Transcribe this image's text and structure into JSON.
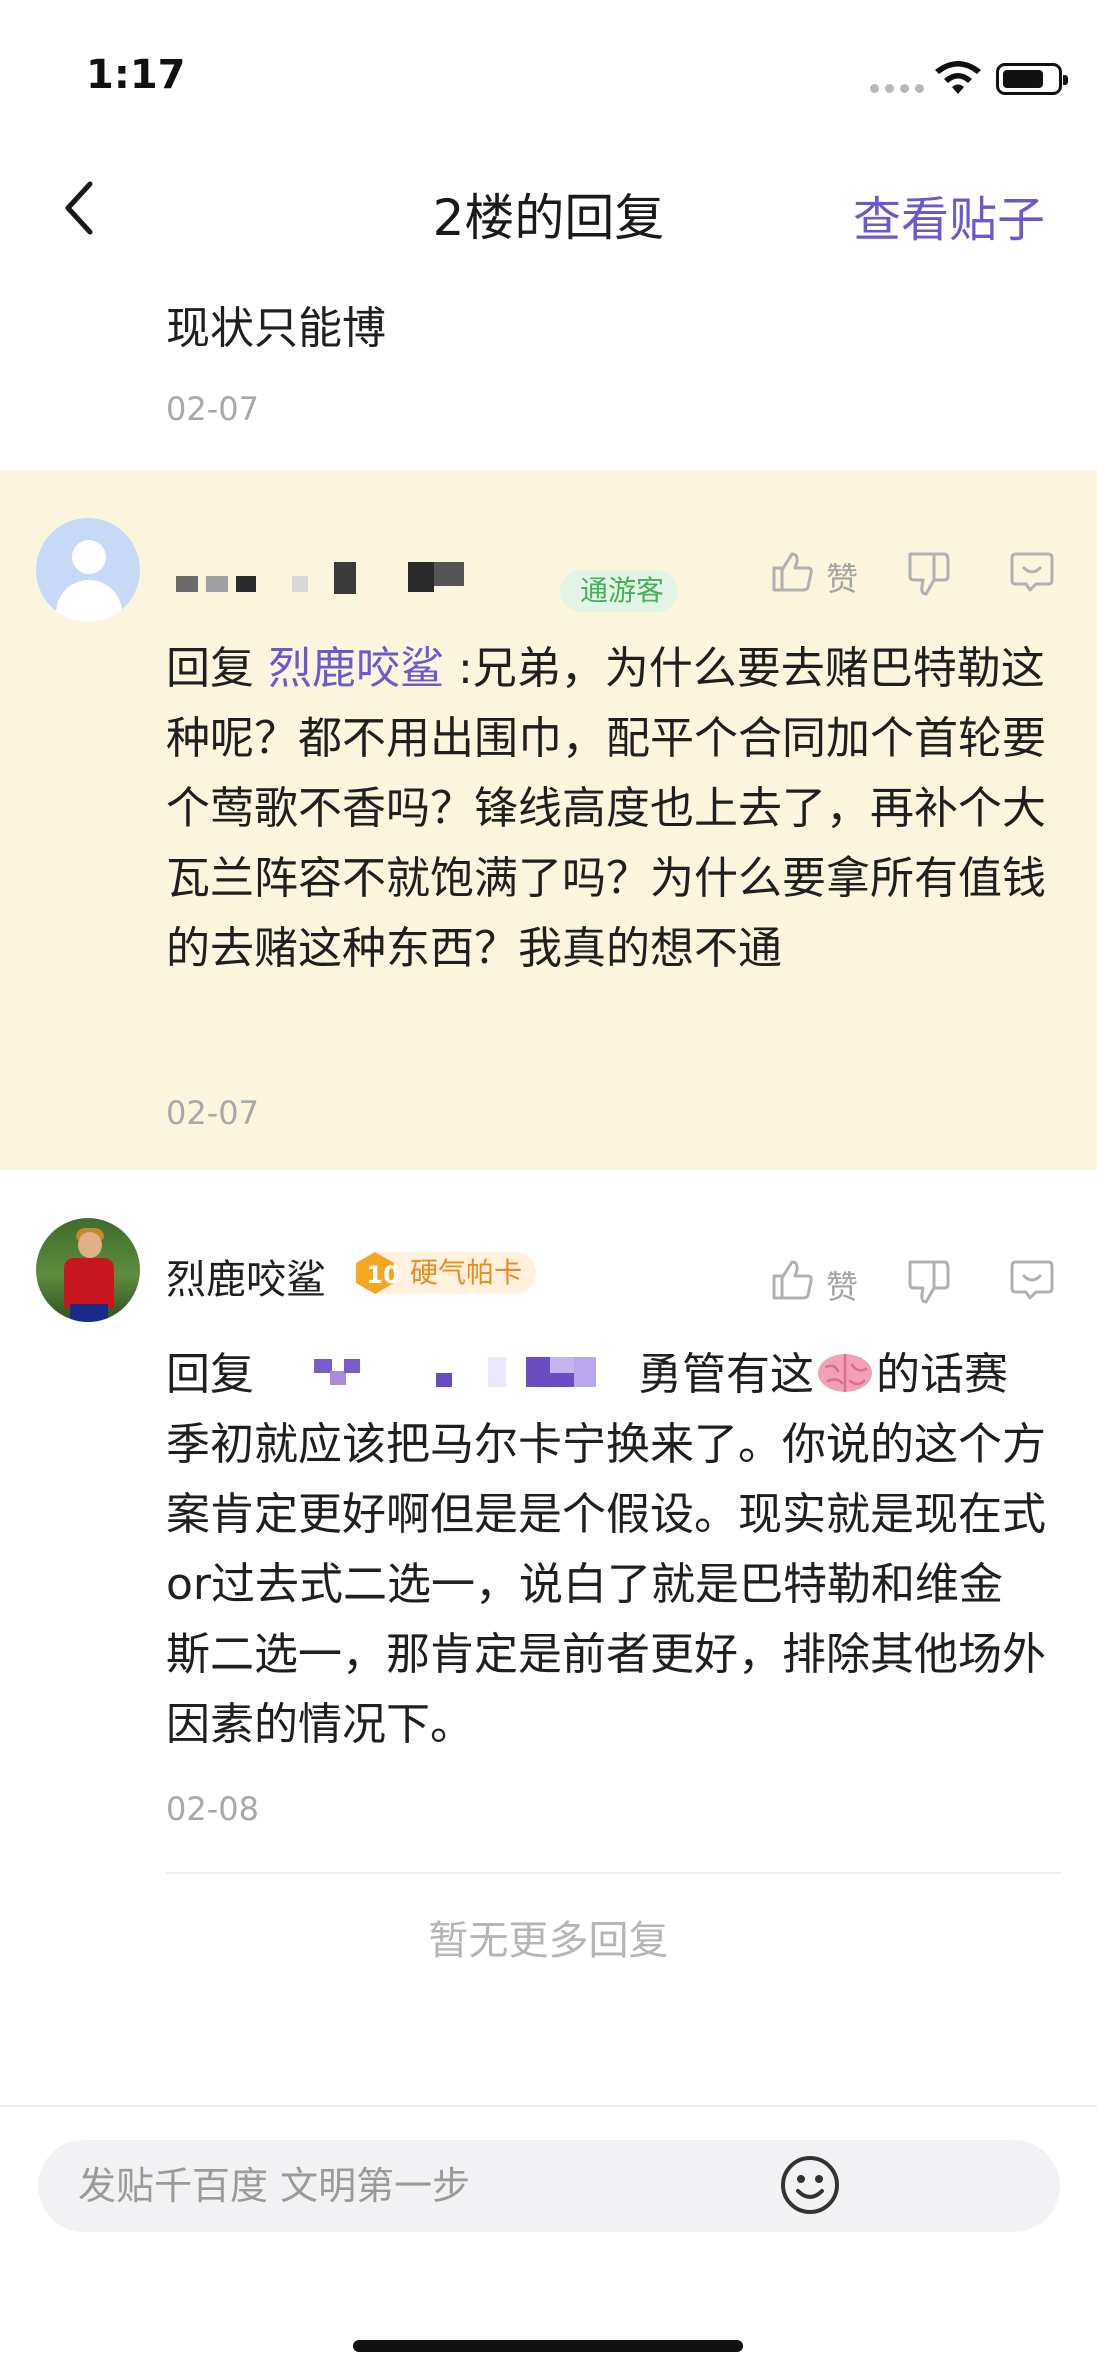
{
  "status_bar": {
    "time": "1:17"
  },
  "nav": {
    "title": "2楼的回复",
    "action_label": "查看贴子"
  },
  "partial_reply": {
    "text": "现状只能博",
    "date": "02-07"
  },
  "replies": [
    {
      "badge": "通游客",
      "reply_prefix": "回复",
      "mention": "烈鹿咬鲨",
      "text": " :兄弟，为什么要去赌巴特勒这种呢？都不用出围巾，配平个合同加个首轮要个莺歌不香吗？锋线高度也上去了，再补个大瓦兰阵容不就饱满了吗？为什么要拿所有值钱的去赌这种东西？我真的想不通",
      "like_label": "赞",
      "date": "02-07"
    },
    {
      "username": "烈鹿咬鲨",
      "level": "10",
      "badge": "硬气帕卡",
      "reply_prefix": "回复",
      "text_before_emoji": "勇管有这",
      "emoji": "brain",
      "text_after_emoji": "的话赛季初就应该把马尔卡宁换来了。你说的这个方案肯定更好啊但是是个假设。现实就是现在式or过去式二选一，说白了就是巴特勒和维金斯二选一，那肯定是前者更好，排除其他场外因素的情况下。",
      "like_label": "赞",
      "date": "02-08"
    }
  ],
  "no_more_text": "暂无更多回复",
  "input": {
    "placeholder": "发贴千百度 文明第一步"
  },
  "colors": {
    "accent": "#6a5acd",
    "highlight_bg": "#fbf5dd",
    "badge_green": "#45b058",
    "badge_orange": "#f08a1d"
  },
  "icons": [
    "back-icon",
    "wifi-icon",
    "battery-icon",
    "like-icon",
    "dislike-icon",
    "comment-icon",
    "emoji-icon",
    "brain-emoji-icon"
  ]
}
